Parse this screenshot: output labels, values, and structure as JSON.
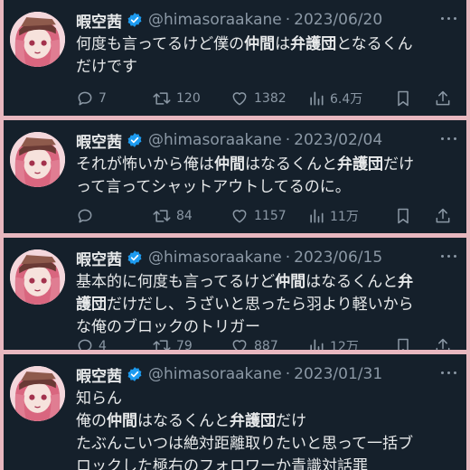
{
  "colors": {
    "panel": "#15202b",
    "text": "#e7e9ea",
    "muted": "#8b98a5",
    "verified": "#1d9bf0",
    "backdrop": "#e8b7bf"
  },
  "icons": {
    "verified": "verified-badge-icon",
    "more": "more-dots-icon",
    "reply": "reply-bubble-icon",
    "retweet": "retweet-icon",
    "like": "heart-icon",
    "views": "bar-chart-icon",
    "bookmark": "bookmark-icon",
    "share": "share-upload-icon"
  },
  "tweets": [
    {
      "name": "暇空茜",
      "handle": "@himasoraakane",
      "sep": "·",
      "date": "2023/06/20",
      "lines": [
        [
          {
            "t": "何度も言ってるけど僕の",
            "b": false
          },
          {
            "t": "仲間",
            "b": true
          },
          {
            "t": "は",
            "b": false
          },
          {
            "t": "弁護団",
            "b": true
          },
          {
            "t": "となるくん",
            "b": false
          }
        ],
        [
          {
            "t": "だけです",
            "b": false
          }
        ]
      ],
      "stats": {
        "reply": "7",
        "retweet": "120",
        "like": "1382",
        "views": "6.4万"
      }
    },
    {
      "name": "暇空茜",
      "handle": "@himasoraakane",
      "sep": "·",
      "date": "2023/02/04",
      "lines": [
        [
          {
            "t": "それが怖いから俺は",
            "b": false
          },
          {
            "t": "仲間",
            "b": true
          },
          {
            "t": "はなるくんと",
            "b": false
          },
          {
            "t": "弁護団",
            "b": true
          },
          {
            "t": "だけ",
            "b": false
          }
        ],
        [
          {
            "t": "って言ってシャットアウトしてるのに。",
            "b": false
          }
        ]
      ],
      "stats": {
        "reply": "",
        "retweet": "84",
        "like": "1157",
        "views": "11万"
      }
    },
    {
      "name": "暇空茜",
      "handle": "@himasoraakane",
      "sep": "·",
      "date": "2023/06/15",
      "lines": [
        [
          {
            "t": "基本的に何度も言ってるけど",
            "b": false
          },
          {
            "t": "仲間",
            "b": true
          },
          {
            "t": "はなるくんと",
            "b": false
          },
          {
            "t": "弁",
            "b": true
          }
        ],
        [
          {
            "t": "護団",
            "b": true
          },
          {
            "t": "だけだし、うざいと思ったら羽より軽いから",
            "b": false
          }
        ],
        [
          {
            "t": "な俺のブロックのトリガー",
            "b": false
          }
        ]
      ],
      "stats": {
        "reply": "4",
        "retweet": "79",
        "like": "887",
        "views": "12万"
      }
    },
    {
      "name": "暇空茜",
      "handle": "@himasoraakane",
      "sep": "·",
      "date": "2023/01/31",
      "lines": [
        [
          {
            "t": "知らん",
            "b": false
          }
        ],
        [
          {
            "t": "俺の",
            "b": false
          },
          {
            "t": "仲間",
            "b": true
          },
          {
            "t": "はなるくんと",
            "b": false
          },
          {
            "t": "弁護団",
            "b": true
          },
          {
            "t": "だけ",
            "b": false
          }
        ],
        [
          {
            "t": "たぶんこいつは絶対距離取りたいと思って一括ブ",
            "b": false
          }
        ],
        [
          {
            "t": "ロックした極右のフォロワーか青識対話罪",
            "b": false
          }
        ]
      ],
      "stats": null
    }
  ]
}
